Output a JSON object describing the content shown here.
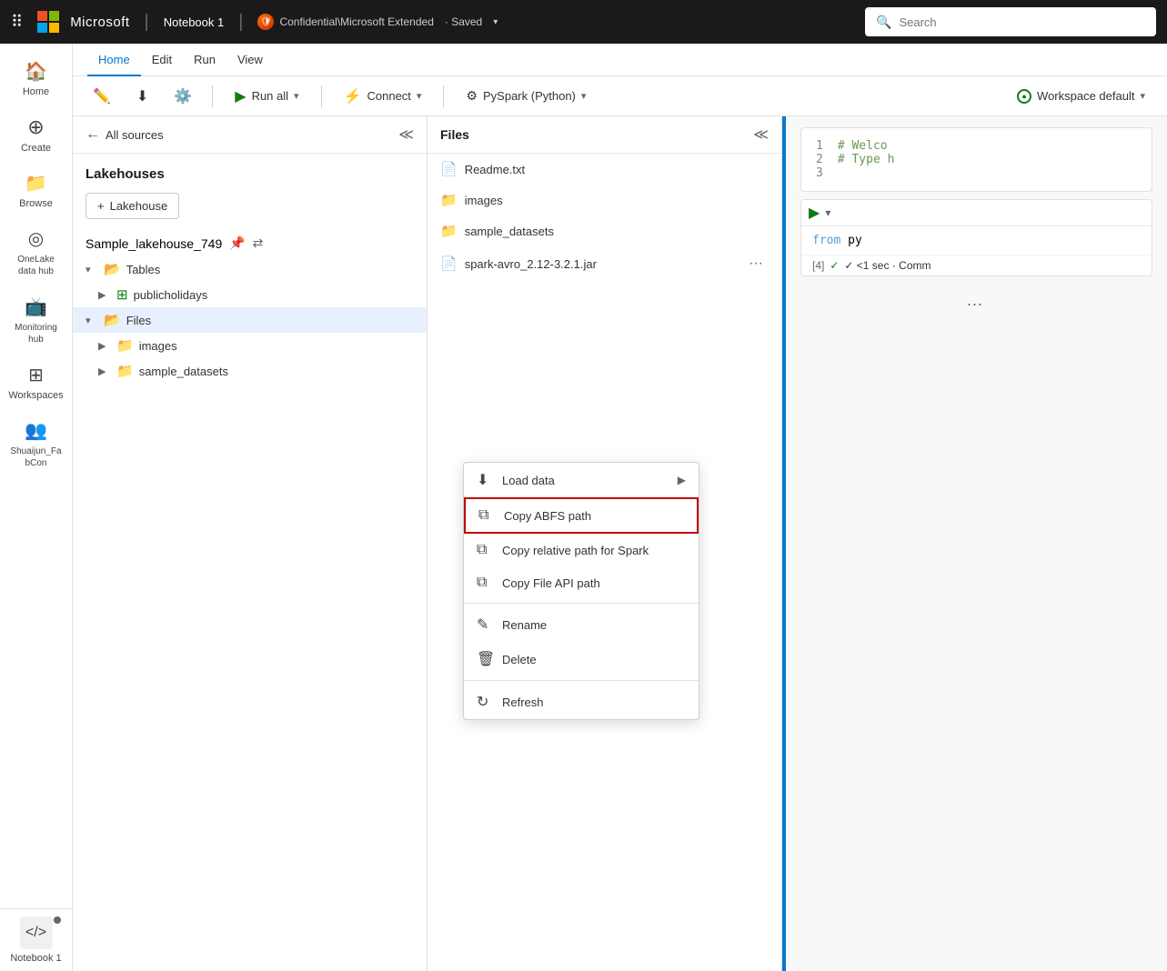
{
  "topbar": {
    "dots": "⠿",
    "brand": "Microsoft",
    "notebook_title": "Notebook 1",
    "confidential": "Confidential\\Microsoft Extended",
    "saved": "· Saved",
    "search_placeholder": "Search"
  },
  "menu": {
    "items": [
      {
        "label": "Home",
        "active": true
      },
      {
        "label": "Edit",
        "active": false
      },
      {
        "label": "Run",
        "active": false
      },
      {
        "label": "View",
        "active": false
      }
    ]
  },
  "toolbar": {
    "run_all": "Run all",
    "connect": "Connect",
    "pyspark": "PySpark (Python)",
    "workspace": "Workspace default"
  },
  "explorer": {
    "back_label": "All sources",
    "title": "Lakehouses",
    "add_label": "Lakehouse",
    "lakehouse_name": "Sample_lakehouse_749",
    "tree": [
      {
        "label": "Tables",
        "indent": 0,
        "type": "section",
        "expanded": true
      },
      {
        "label": "publicholidays",
        "indent": 1,
        "type": "table"
      },
      {
        "label": "Files",
        "indent": 0,
        "type": "section",
        "expanded": true,
        "selected": true
      },
      {
        "label": "images",
        "indent": 1,
        "type": "folder"
      },
      {
        "label": "sample_datasets",
        "indent": 1,
        "type": "folder"
      }
    ]
  },
  "files": {
    "title": "Files",
    "items": [
      {
        "name": "Readme.txt",
        "type": "file"
      },
      {
        "name": "images",
        "type": "folder"
      },
      {
        "name": "sample_datasets",
        "type": "folder"
      },
      {
        "name": "spark-avro_2.12-3.2.1.jar",
        "type": "file"
      }
    ]
  },
  "context_menu": {
    "items": [
      {
        "label": "Load data",
        "icon": "⬇",
        "has_chevron": true,
        "highlighted": false
      },
      {
        "label": "Copy ABFS path",
        "icon": "⧉",
        "highlighted": true
      },
      {
        "label": "Copy relative path for Spark",
        "icon": "⧉",
        "highlighted": false
      },
      {
        "label": "Copy File API path",
        "icon": "⧉",
        "highlighted": false
      },
      {
        "sep": true
      },
      {
        "label": "Rename",
        "icon": "✎",
        "highlighted": false
      },
      {
        "label": "Delete",
        "icon": "🗑",
        "highlighted": false
      },
      {
        "sep": true
      },
      {
        "label": "Refresh",
        "icon": "↻",
        "highlighted": false
      }
    ]
  },
  "notebook": {
    "lines": [
      {
        "num": "1",
        "code": "# Welco"
      },
      {
        "num": "2",
        "code": "# Type h"
      },
      {
        "num": "3",
        "code": ""
      }
    ],
    "cell": {
      "exec_num": "[4]",
      "code": "from py",
      "status": "✓  <1 sec · Comm"
    }
  },
  "sidebar_items": [
    {
      "label": "Home",
      "icon": "🏠"
    },
    {
      "label": "Create",
      "icon": "+"
    },
    {
      "label": "Browse",
      "icon": "📁"
    },
    {
      "label": "OneLake\ndata hub",
      "icon": "◎"
    },
    {
      "label": "Monitoring\nhub",
      "icon": "📺"
    },
    {
      "label": "Workspaces",
      "icon": "⊞"
    },
    {
      "label": "Shuaijun_Fa\nbCon",
      "icon": "👥"
    }
  ],
  "notebook_bottom": {
    "label": "Notebook 1"
  }
}
